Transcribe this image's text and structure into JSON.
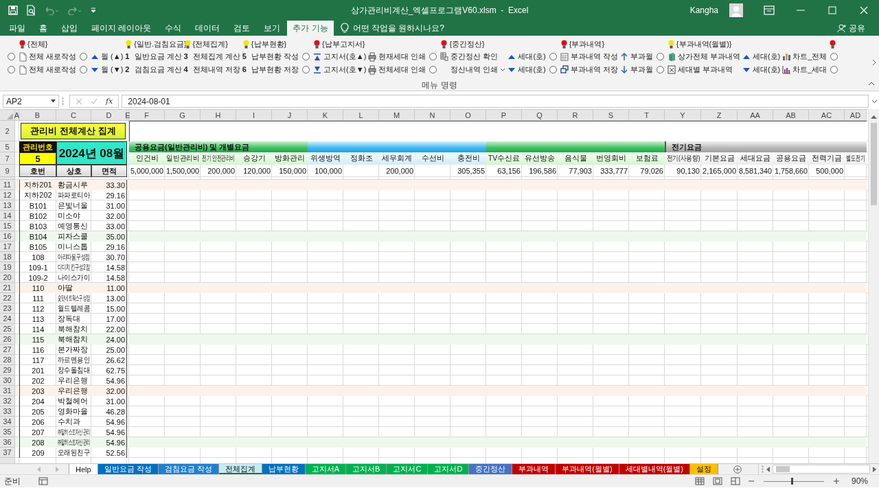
{
  "titlebar": {
    "title": "상가관리비계산_엑셀프로그램V60.xlsm  -  Excel",
    "user": "Kangha"
  },
  "menu": {
    "tabs": [
      {
        "label": "파일",
        "selected": false
      },
      {
        "label": "홈",
        "selected": false
      },
      {
        "label": "삽입",
        "selected": false
      },
      {
        "label": "페이지 레이아웃",
        "selected": false
      },
      {
        "label": "수식",
        "selected": false
      },
      {
        "label": "데이터",
        "selected": false
      },
      {
        "label": "검토",
        "selected": false
      },
      {
        "label": "보기",
        "selected": false
      },
      {
        "label": "추가 기능",
        "selected": true
      }
    ],
    "tell_me": {
      "placeholder": "어떤 작업을 원하시나요?"
    },
    "share": "공유"
  },
  "ribbon": {
    "columns": [
      {
        "items": [
          {
            "kind": "radio",
            "selected": false
          },
          {
            "kind": "radio",
            "selected": false
          }
        ]
      },
      {
        "header": {
          "label": "{전체}",
          "color": "#e01010"
        },
        "items": [
          {
            "kind": "button",
            "label": "전체 새로작성"
          },
          {
            "kind": "button",
            "label": "전체 새로작성"
          }
        ]
      },
      {
        "items": [
          {
            "kind": "radio",
            "selected": false
          },
          {
            "kind": "radio",
            "selected": false
          }
        ]
      },
      {
        "items": [
          {
            "kind": "button",
            "label": "월 (▲)"
          },
          {
            "kind": "button",
            "label": "월 (▼)"
          }
        ]
      },
      {
        "header": {
          "label": "{일반.검침요금}",
          "color": "#f2e600"
        },
        "items": [
          {
            "kind": "button",
            "label": "**1** 일반요금 계산"
          },
          {
            "kind": "button",
            "label": "**2** 검침요금 계산"
          }
        ]
      },
      {
        "header": {
          "label": "{전체집계}",
          "color": "#f2e600"
        },
        "items": [
          {
            "kind": "button",
            "label": "**3** 전체집계 계산"
          },
          {
            "kind": "button",
            "label": "**4** 전체내역 저장"
          }
        ]
      },
      {
        "header": {
          "label": "{납부현황}",
          "color": "#f2e600"
        },
        "items": [
          {
            "kind": "button",
            "label": "**5** 납부현황 작성"
          },
          {
            "kind": "button",
            "label": "**6** 납부현황 저장"
          }
        ]
      },
      {
        "items": [
          {
            "kind": "radio",
            "selected": false
          },
          {
            "kind": "radio",
            "selected": false
          }
        ]
      },
      {
        "header": {
          "label": "{납부고지서}",
          "color": "#e01010"
        },
        "items": [
          {
            "kind": "button",
            "label": "고지서(호▲)"
          },
          {
            "kind": "button",
            "label": "고지서(호▼)"
          }
        ]
      },
      {
        "items": [
          {
            "kind": "button",
            "label": "현재세대 인쇄"
          },
          {
            "kind": "button",
            "label": "전체세대 인쇄"
          }
        ]
      },
      {
        "items": [
          {
            "kind": "radio",
            "selected": false
          },
          {
            "kind": "radio",
            "selected": false
          }
        ]
      },
      {
        "header": {
          "label": "{중간정산}",
          "color": "#e01010"
        },
        "items": [
          {
            "kind": "button",
            "label": "중간정산 확인"
          },
          {
            "kind": "dropdown",
            "label": "정산내역 인쇄"
          }
        ]
      },
      {
        "items": [
          {
            "kind": "button",
            "label": "세대(호)"
          },
          {
            "kind": "button",
            "label": "세대(호)"
          }
        ]
      },
      {
        "items": [
          {
            "kind": "radio",
            "selected": false
          },
          {
            "kind": "radio",
            "selected": false
          }
        ]
      },
      {
        "header": {
          "label": "{부과내역}",
          "color": "#e01010"
        },
        "items": [
          {
            "kind": "button",
            "label": "부과내역 작성"
          },
          {
            "kind": "button",
            "label": "부과내역 저장"
          }
        ]
      },
      {
        "items": [
          {
            "kind": "button",
            "label": "부과월"
          },
          {
            "kind": "button",
            "label": "부과월"
          }
        ]
      },
      {
        "items": [
          {
            "kind": "radio",
            "selected": false
          },
          {
            "kind": "radio",
            "selected": false
          }
        ]
      },
      {
        "header": {
          "label": "{부과내역(월별)}",
          "color": "#f2e600"
        },
        "items": [
          {
            "kind": "button",
            "label": "상가전체 부과내역"
          },
          {
            "kind": "button",
            "label": "세대별 부과내역"
          }
        ]
      },
      {
        "items": [
          {
            "kind": "button",
            "label": "세대(호)"
          },
          {
            "kind": "button",
            "label": "세대(호)"
          }
        ]
      },
      {
        "items": [
          {
            "kind": "button",
            "label": "차트_전체"
          },
          {
            "kind": "button",
            "label": "차트_세대"
          }
        ]
      },
      {
        "header": {
          "color": "#e01010"
        },
        "items": [
          {
            "kind": "radio",
            "selected": false
          },
          {
            "kind": "radio",
            "selected": false
          }
        ]
      }
    ],
    "group_label": "메뉴 명령"
  },
  "formula_bar": {
    "name_box": "AP2",
    "fx_label": "fx",
    "value": "2024-08-01"
  },
  "sheet": {
    "columns": [
      "A",
      "B",
      "C",
      "D",
      "E",
      "F",
      "G",
      "H",
      "I",
      "J",
      "K",
      "L",
      "M",
      "N",
      "O",
      "P",
      "Q",
      "R",
      "S",
      "T",
      "Y",
      "Z",
      "AA",
      "AB",
      "AC",
      "AD"
    ],
    "header_rows": [
      "2",
      "5",
      "7",
      "9"
    ],
    "title": "관리비 전체계산 집계",
    "id_label": "관리번호",
    "id_value": "5",
    "month": "2024년 08월",
    "sections": [
      {
        "label": "공용요금(일반관리비) 및 개별요금"
      },
      {
        "label": "전기요금"
      }
    ],
    "list_headers": [
      "호번",
      "상호",
      "면적"
    ],
    "fees": [
      {
        "label": "인건비",
        "kind": "green",
        "value": "5,000,000"
      },
      {
        "label": "일반관리비",
        "kind": "green",
        "value": "1,500,000"
      },
      {
        "label": "전기 안전관리비",
        "kind": "green",
        "value": "200,000"
      },
      {
        "label": "승강기",
        "kind": "green",
        "value": "120,000"
      },
      {
        "label": "방화관리",
        "kind": "green",
        "value": "150,000"
      },
      {
        "label": "위생방역",
        "kind": "blue",
        "value": "100,000"
      },
      {
        "label": "정화조",
        "kind": "blue"
      },
      {
        "label": "세무회계",
        "kind": "blue",
        "value": "200,000"
      },
      {
        "label": "수선비",
        "kind": "blue"
      },
      {
        "label": "충전비",
        "kind": "blue",
        "value": "305,355"
      },
      {
        "label": "TV수신료",
        "kind": "green",
        "value": "63,156"
      },
      {
        "label": "유선방송",
        "kind": "green",
        "value": "196,586"
      },
      {
        "label": "음식물",
        "kind": "green",
        "value": "77,903"
      },
      {
        "label": "번영회비",
        "kind": "green",
        "value": "333,777"
      },
      {
        "label": "보험료",
        "kind": "green",
        "value": "79,026"
      },
      {
        "label": "전기(사용량)",
        "kind": "gray",
        "value": "90,130"
      },
      {
        "label": "기본요금",
        "kind": "gray",
        "value": "2,165,000"
      },
      {
        "label": "세대요금",
        "kind": "gray",
        "value": "8,581,340"
      },
      {
        "label": "공용요금",
        "kind": "gray",
        "value": "1,758,660"
      },
      {
        "label": "전력기금",
        "kind": "gray",
        "value": "500,000"
      },
      {
        "label": "별도전기",
        "kind": "gray"
      }
    ],
    "rows": [
      {
        "number": "11",
        "id": "지하201",
        "name": "황금시루",
        "area": "33.30",
        "color": "#fdf2e9"
      },
      {
        "number": "12",
        "id": "지하202",
        "name": "파파로티아",
        "area": "29.16"
      },
      {
        "number": "13",
        "id": "B101",
        "name": "은빛너울",
        "area": "31.00"
      },
      {
        "number": "14",
        "id": "B102",
        "name": "미소야",
        "area": "32.00"
      },
      {
        "number": "15",
        "id": "B103",
        "name": "예영통신",
        "area": "33.00"
      },
      {
        "number": "16",
        "id": "B104",
        "name": "피자스쿨",
        "area": "35.00",
        "color": "#eef8ec"
      },
      {
        "number": "17",
        "id": "B105",
        "name": "미니스톱",
        "area": "29.16"
      },
      {
        "number": "18",
        "id": "108",
        "name": "아리따움구성점",
        "area": "30.70"
      },
      {
        "number": "19",
        "id": "109-1",
        "name": "디디치킨구성2점",
        "area": "14.58"
      },
      {
        "number": "20",
        "id": "109-2",
        "name": "나이스가이",
        "area": "14.58"
      },
      {
        "number": "21",
        "id": "110",
        "name": "아딸",
        "area": "11.00",
        "color": "#fdf2e9"
      },
      {
        "number": "22",
        "id": "111",
        "name": "숯맛네트웍스구성점",
        "area": "13.00"
      },
      {
        "number": "23",
        "id": "112",
        "name": "월드텔레콤",
        "area": "15.00"
      },
      {
        "number": "24",
        "id": "113",
        "name": "장독대",
        "area": "17.00"
      },
      {
        "number": "25",
        "id": "114",
        "name": "북해참치",
        "area": "22.00"
      },
      {
        "number": "26",
        "id": "115",
        "name": "북해참치",
        "area": "24.00",
        "color": "#eef8ec"
      },
      {
        "number": "27",
        "id": "116",
        "name": "본가짜장",
        "area": "25.00"
      },
      {
        "number": "28",
        "id": "117",
        "name": "까르멘용인",
        "area": "26.62"
      },
      {
        "number": "29",
        "id": "201",
        "name": "장수돌침대",
        "area": "62.75"
      },
      {
        "number": "30",
        "id": "202",
        "name": "우리은행",
        "area": "54.96"
      },
      {
        "number": "31",
        "id": "203",
        "name": "우리은행",
        "area": "32.00",
        "color": "#fdf2e9"
      },
      {
        "number": "32",
        "id": "204",
        "name": "박철헤어",
        "area": "31.00"
      },
      {
        "number": "33",
        "id": "205",
        "name": "영화마을",
        "area": "46.28"
      },
      {
        "number": "34",
        "id": "206",
        "name": "수치과",
        "area": "54.96"
      },
      {
        "number": "35",
        "id": "207",
        "name": "㈜말히스토자산관리",
        "area": "54.96"
      },
      {
        "number": "36",
        "id": "208",
        "name": "㈜말히스토자산관리",
        "area": "54.96",
        "color": "#eef8ec"
      },
      {
        "number": "37",
        "id": "209",
        "name": "오래된친구",
        "area": "52.56"
      }
    ]
  },
  "sheet_tabs": [
    {
      "label": "Help",
      "color": "#ffffff",
      "selected": false
    },
    {
      "label": "일반요금 작성",
      "color": "#0070c0",
      "selected": false
    },
    {
      "label": "검침요금 작성",
      "color": "#1f80d0",
      "selected": false
    },
    {
      "label": "전체집계",
      "color": "#c6ecf2",
      "selected": true
    },
    {
      "label": "납부현황",
      "color": "#0070c0",
      "selected": false
    },
    {
      "label": "고지서A",
      "color": "#00b050",
      "selected": false
    },
    {
      "label": "고지서B",
      "color": "#00b050",
      "selected": false
    },
    {
      "label": "고지서C",
      "color": "#00b050",
      "selected": false
    },
    {
      "label": "고지서D",
      "color": "#00b050",
      "selected": false
    },
    {
      "label": "중간정산",
      "color": "#4472c4",
      "selected": false
    },
    {
      "label": "부과내역",
      "color": "#c00000",
      "selected": false
    },
    {
      "label": "부과내역(월별)",
      "color": "#c00000",
      "selected": false
    },
    {
      "label": "세대별내역(월별)",
      "color": "#c00000",
      "selected": false
    },
    {
      "label": "설정",
      "color": "#ffc000",
      "selected": false
    }
  ],
  "status_bar": {
    "status": "준비",
    "zoom": {
      "level": 0.47,
      "reading": "90%"
    }
  }
}
